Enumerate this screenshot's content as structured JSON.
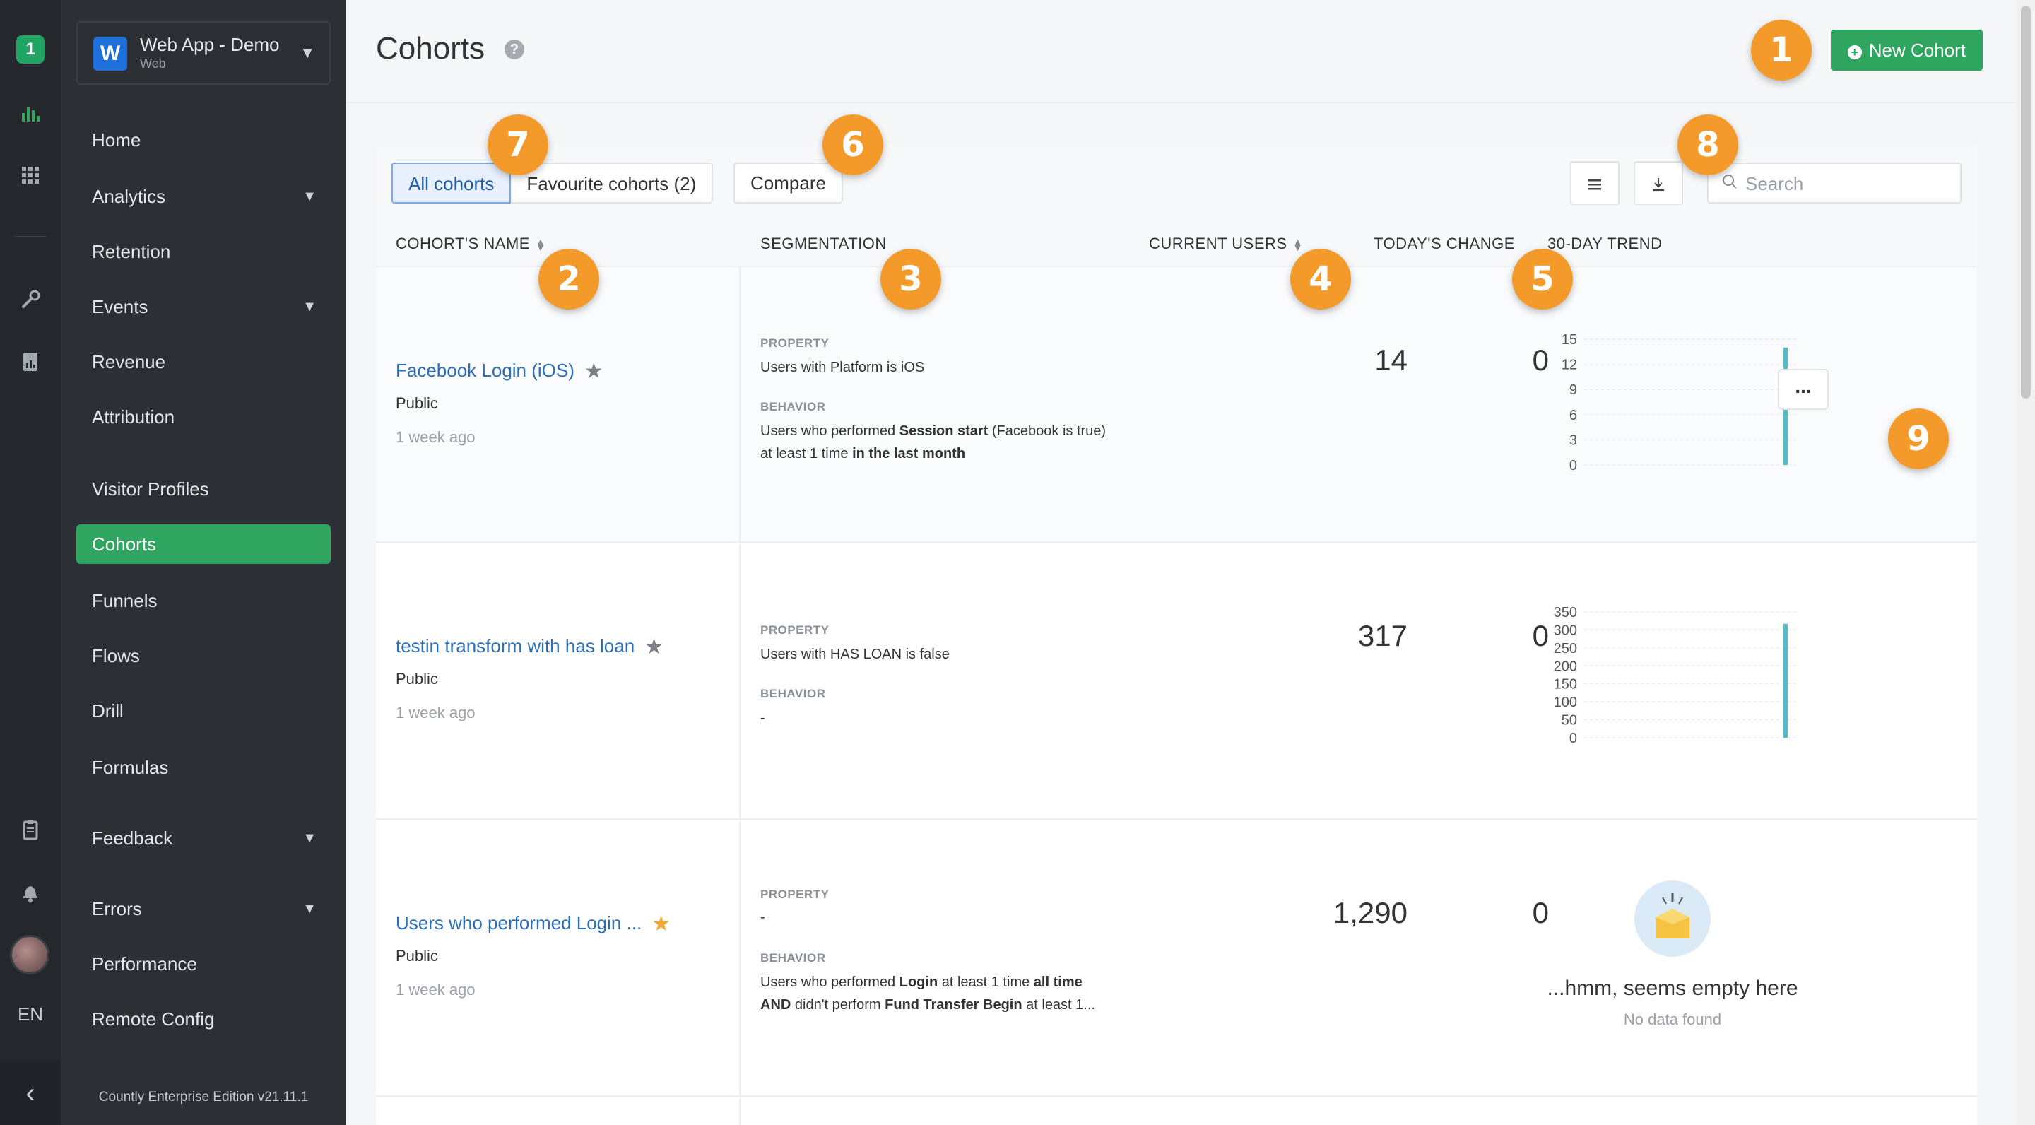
{
  "rail": {
    "language": "EN"
  },
  "app": {
    "letter": "W",
    "name": "Web App - Demo",
    "type": "Web"
  },
  "sidebar": {
    "items": [
      {
        "label": "Home",
        "has_caret": false
      },
      {
        "label": "Analytics",
        "has_caret": true
      },
      {
        "label": "Retention",
        "has_caret": false
      },
      {
        "label": "Events",
        "has_caret": true
      },
      {
        "label": "Revenue",
        "has_caret": false
      },
      {
        "label": "Attribution",
        "has_caret": false
      },
      {
        "label": "Visitor Profiles",
        "has_caret": false
      },
      {
        "label": "Cohorts",
        "has_caret": false,
        "active": true
      },
      {
        "label": "Funnels",
        "has_caret": false
      },
      {
        "label": "Flows",
        "has_caret": false
      },
      {
        "label": "Drill",
        "has_caret": false
      },
      {
        "label": "Formulas",
        "has_caret": false
      },
      {
        "label": "Feedback",
        "has_caret": true
      },
      {
        "label": "Errors",
        "has_caret": true
      },
      {
        "label": "Performance",
        "has_caret": false
      },
      {
        "label": "Remote Config",
        "has_caret": false
      }
    ],
    "footer": "Countly Enterprise Edition v21.11.1"
  },
  "header": {
    "title": "Cohorts",
    "help": "?",
    "new_button": "New Cohort"
  },
  "toolbar": {
    "tabs": [
      "All cohorts",
      "Favourite cohorts (2)"
    ],
    "compare": "Compare",
    "search_placeholder": "Search"
  },
  "table": {
    "columns": [
      "COHORT'S NAME",
      "SEGMENTATION",
      "CURRENT USERS",
      "TODAY'S CHANGE",
      "30-DAY TREND"
    ],
    "property_label": "PROPERTY",
    "behavior_label": "BEHAVIOR",
    "rows": [
      {
        "name": "Facebook Login (iOS)",
        "favourite": false,
        "visibility": "Public",
        "time": "1 week ago",
        "property": "Users with Platform is iOS",
        "behavior_html": "Users who performed <b>Session start</b> (Facebook is true) at least 1 time <b>in the last month</b>",
        "current_users": "14",
        "todays_change": "0"
      },
      {
        "name": "testin transform with has loan",
        "favourite": false,
        "visibility": "Public",
        "time": "1 week ago",
        "property": "Users with HAS LOAN is false",
        "behavior_html": "-",
        "current_users": "317",
        "todays_change": "0"
      },
      {
        "name": "Users who performed Login ...",
        "favourite": true,
        "visibility": "Public",
        "time": "1 week ago",
        "property": "-",
        "behavior_html": "Users who performed <b>Login</b> at least 1 time <b>all time</b><br><b>AND</b> didn't perform <b>Fund Transfer Begin</b> at least 1...",
        "current_users": "1,290",
        "todays_change": "0"
      }
    ],
    "empty_title": "...hmm, seems empty here",
    "empty_sub": "No data found",
    "more": "..."
  },
  "chart_data": [
    {
      "type": "bar",
      "ylim": [
        0,
        15
      ],
      "yticks": [
        "0",
        "3",
        "6",
        "9",
        "12",
        "15"
      ],
      "values": [
        0,
        0,
        0,
        0,
        0,
        0,
        0,
        0,
        0,
        0,
        0,
        0,
        0,
        0,
        0,
        0,
        0,
        0,
        0,
        0,
        0,
        0,
        0,
        0,
        0,
        0,
        0,
        0,
        14,
        0
      ],
      "color": "#52bdc9"
    },
    {
      "type": "bar",
      "ylim": [
        0,
        350
      ],
      "yticks": [
        "0",
        "50",
        "100",
        "150",
        "200",
        "250",
        "300",
        "350"
      ],
      "values": [
        0,
        0,
        0,
        0,
        0,
        0,
        0,
        0,
        0,
        0,
        0,
        0,
        0,
        0,
        0,
        0,
        0,
        0,
        0,
        0,
        0,
        0,
        0,
        0,
        0,
        0,
        0,
        0,
        317,
        0
      ],
      "color": "#52bdc9"
    }
  ],
  "annotations": [
    "1",
    "2",
    "3",
    "4",
    "5",
    "6",
    "7",
    "8",
    "9"
  ],
  "colors": {
    "brand_green": "#2fa55f",
    "annotation_orange": "#f39a2b",
    "link_blue": "#2d6fb8",
    "trend_bar": "#52bdc9"
  }
}
